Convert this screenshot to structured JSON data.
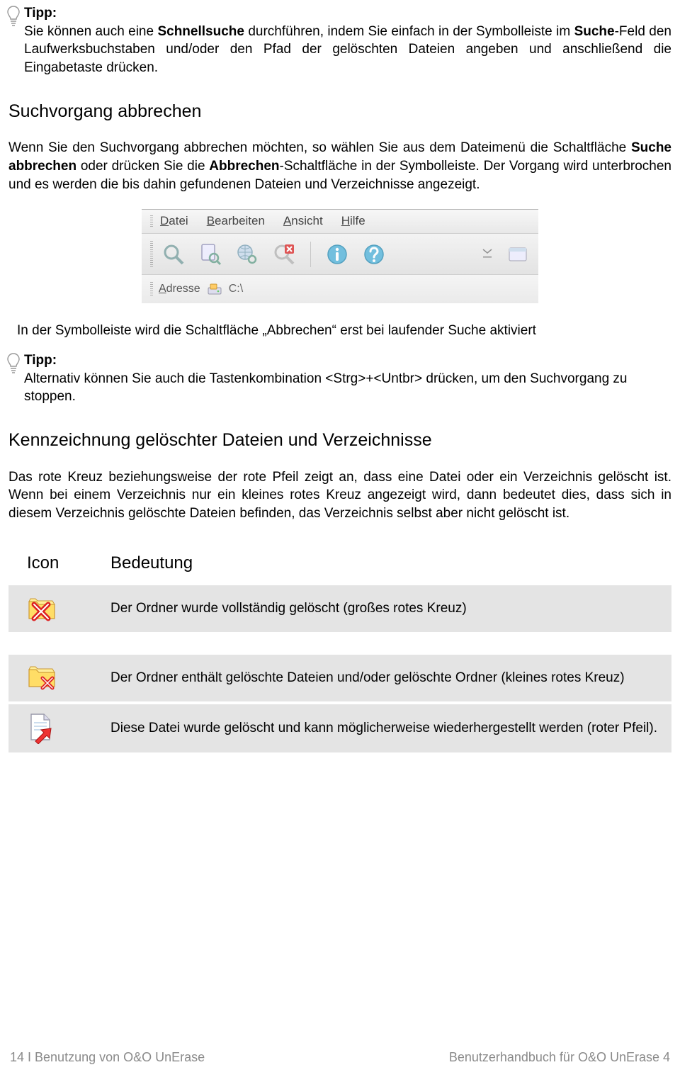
{
  "tip1": {
    "label": "Tipp:",
    "text_parts": [
      "Sie können auch eine ",
      "Schnellsuche",
      " durchführen, indem Sie einfach in der Symbolleiste im ",
      "Suche",
      "-Feld den Laufwerksbuchstaben und/oder den Pfad der gelöschten Dateien angeben und anschließend die Eingabetaste drücken."
    ]
  },
  "section1": {
    "heading": "Suchvorgang abbrechen",
    "para_parts": [
      "Wenn Sie den Suchvorgang abbrechen möchten, so wählen Sie aus dem Dateimenü die Schaltfläche ",
      "Suche abbrechen",
      " oder drücken Sie die ",
      "Abbrechen",
      "-Schaltfläche in der Symbolleiste. Der Vorgang wird unterbrochen und es werden die bis dahin gefundenen Dateien und Verzeichnisse angezeigt."
    ]
  },
  "figure": {
    "menus": {
      "datei": "Datei",
      "bearbeiten": "Bearbeiten",
      "ansicht": "Ansicht",
      "hilfe": "Hilfe"
    },
    "address_label": "Adresse",
    "address_value": "C:\\",
    "caption": "In der Symbolleiste wird die Schaltfläche „Abbrechen“ erst bei laufender Suche aktiviert"
  },
  "tip2": {
    "label": "Tipp:",
    "text": "Alternativ können Sie auch die Tastenkombination <Strg>+<Untbr> drücken, um den Suchvorgang zu stoppen."
  },
  "section2": {
    "heading": "Kennzeichnung gelöschter Dateien und Verzeichnisse",
    "para": "Das rote Kreuz beziehungsweise der rote Pfeil zeigt an, dass eine Datei oder ein Verzeichnis gelöscht ist. Wenn bei einem Verzeichnis nur ein kleines rotes Kreuz angezeigt wird, dann bedeutet dies, dass sich in diesem Verzeichnis gelöschte Dateien befinden, das Verzeichnis selbst aber nicht gelöscht ist."
  },
  "table": {
    "header": {
      "icon": "Icon",
      "meaning": "Bedeutung"
    },
    "rows": [
      {
        "icon": "folder-deleted-full",
        "text": "Der Ordner wurde vollständig gelöscht (großes rotes Kreuz)"
      },
      {
        "icon": "folder-deleted-partial",
        "text": "Der Ordner enthält gelöschte Dateien und/oder gelöschte Ordner (kleines rotes Kreuz)"
      },
      {
        "icon": "file-deleted",
        "text": "Diese Datei wurde gelöscht und kann möglicherweise wiederhergestellt werden (roter Pfeil)."
      }
    ]
  },
  "footer": {
    "left": "14  I  Benutzung von O&O UnErase",
    "right": "Benutzerhandbuch für O&O UnErase 4"
  }
}
